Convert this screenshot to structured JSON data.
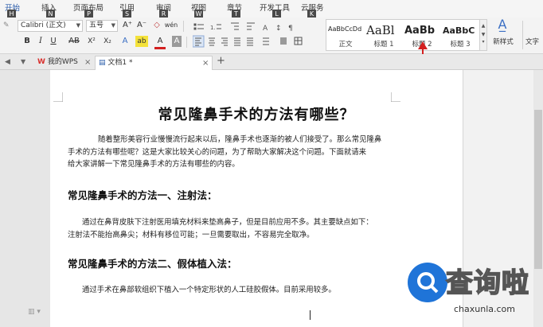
{
  "menu": [
    {
      "label": "开始",
      "key": "H",
      "active": true
    },
    {
      "label": "插入",
      "key": "N"
    },
    {
      "label": "页面布局",
      "key": "P"
    },
    {
      "label": "引用",
      "key": "S"
    },
    {
      "label": "审阅",
      "key": "R"
    },
    {
      "label": "视图",
      "key": "W"
    },
    {
      "label": "章节",
      "key": "T"
    },
    {
      "label": "开发工具",
      "key": "L"
    },
    {
      "label": "云服务",
      "key": "K"
    }
  ],
  "ribbon": {
    "font_name": "Calibri (正文)",
    "font_size": "五号",
    "grow_font": "A⁺",
    "shrink_font": "A⁻",
    "clear_format": "◇",
    "wen": "wén",
    "bold": "B",
    "italic": "I",
    "underline": "U",
    "strike": "AB",
    "superscript": "X²",
    "subscript": "X₂",
    "text_effect": "A",
    "highlight": "ab",
    "font_color": "A",
    "char_shade": "A",
    "new_style_label": "新样式",
    "text_tools_label": "文字"
  },
  "styles": [
    {
      "preview": "AaBbCcDd",
      "name": "正文"
    },
    {
      "preview": "AaBl",
      "name": "标题 1"
    },
    {
      "preview": "AaBb",
      "name": "标题 2"
    },
    {
      "preview": "AaBbC",
      "name": "标题 3"
    }
  ],
  "tabs": [
    {
      "label": "我的WPS"
    },
    {
      "label": "文档1 *"
    }
  ],
  "document": {
    "title": "常见隆鼻手术的方法有哪些？",
    "intro": [
      "随着整形美容行业慢慢流行起来以后，隆鼻手术也逐渐的被人们接受了。那么常见隆鼻",
      "手术的方法有哪些呢？这是大家比较关心的问题，为了帮助大家解决这个问题。下面就请来",
      "给大家讲解一下常见隆鼻手术的方法有哪些的内容。"
    ],
    "h1": "常见隆鼻手术的方法一、注射法：",
    "p1": [
      "通过在鼻背皮肤下注射医用填充材料来垫高鼻子，但是目前应用不多。其主要缺点如下：",
      "注射法不能抬高鼻尖；材料有移位可能；一旦需要取出，不容易完全取净。"
    ],
    "h2": "常见隆鼻手术的方法二、假体植入法：",
    "p2": [
      "通过手术在鼻部软组织下植入一个特定形状的人工硅胶假体。目前采用较多。"
    ]
  },
  "watermark": {
    "text": "查询啦",
    "url": "chaxunla.com"
  },
  "colors": {
    "accent": "#2a5caa",
    "arrow": "#d32020",
    "watermark_blue": "#1f74d8",
    "wps_red": "#d9322f"
  }
}
